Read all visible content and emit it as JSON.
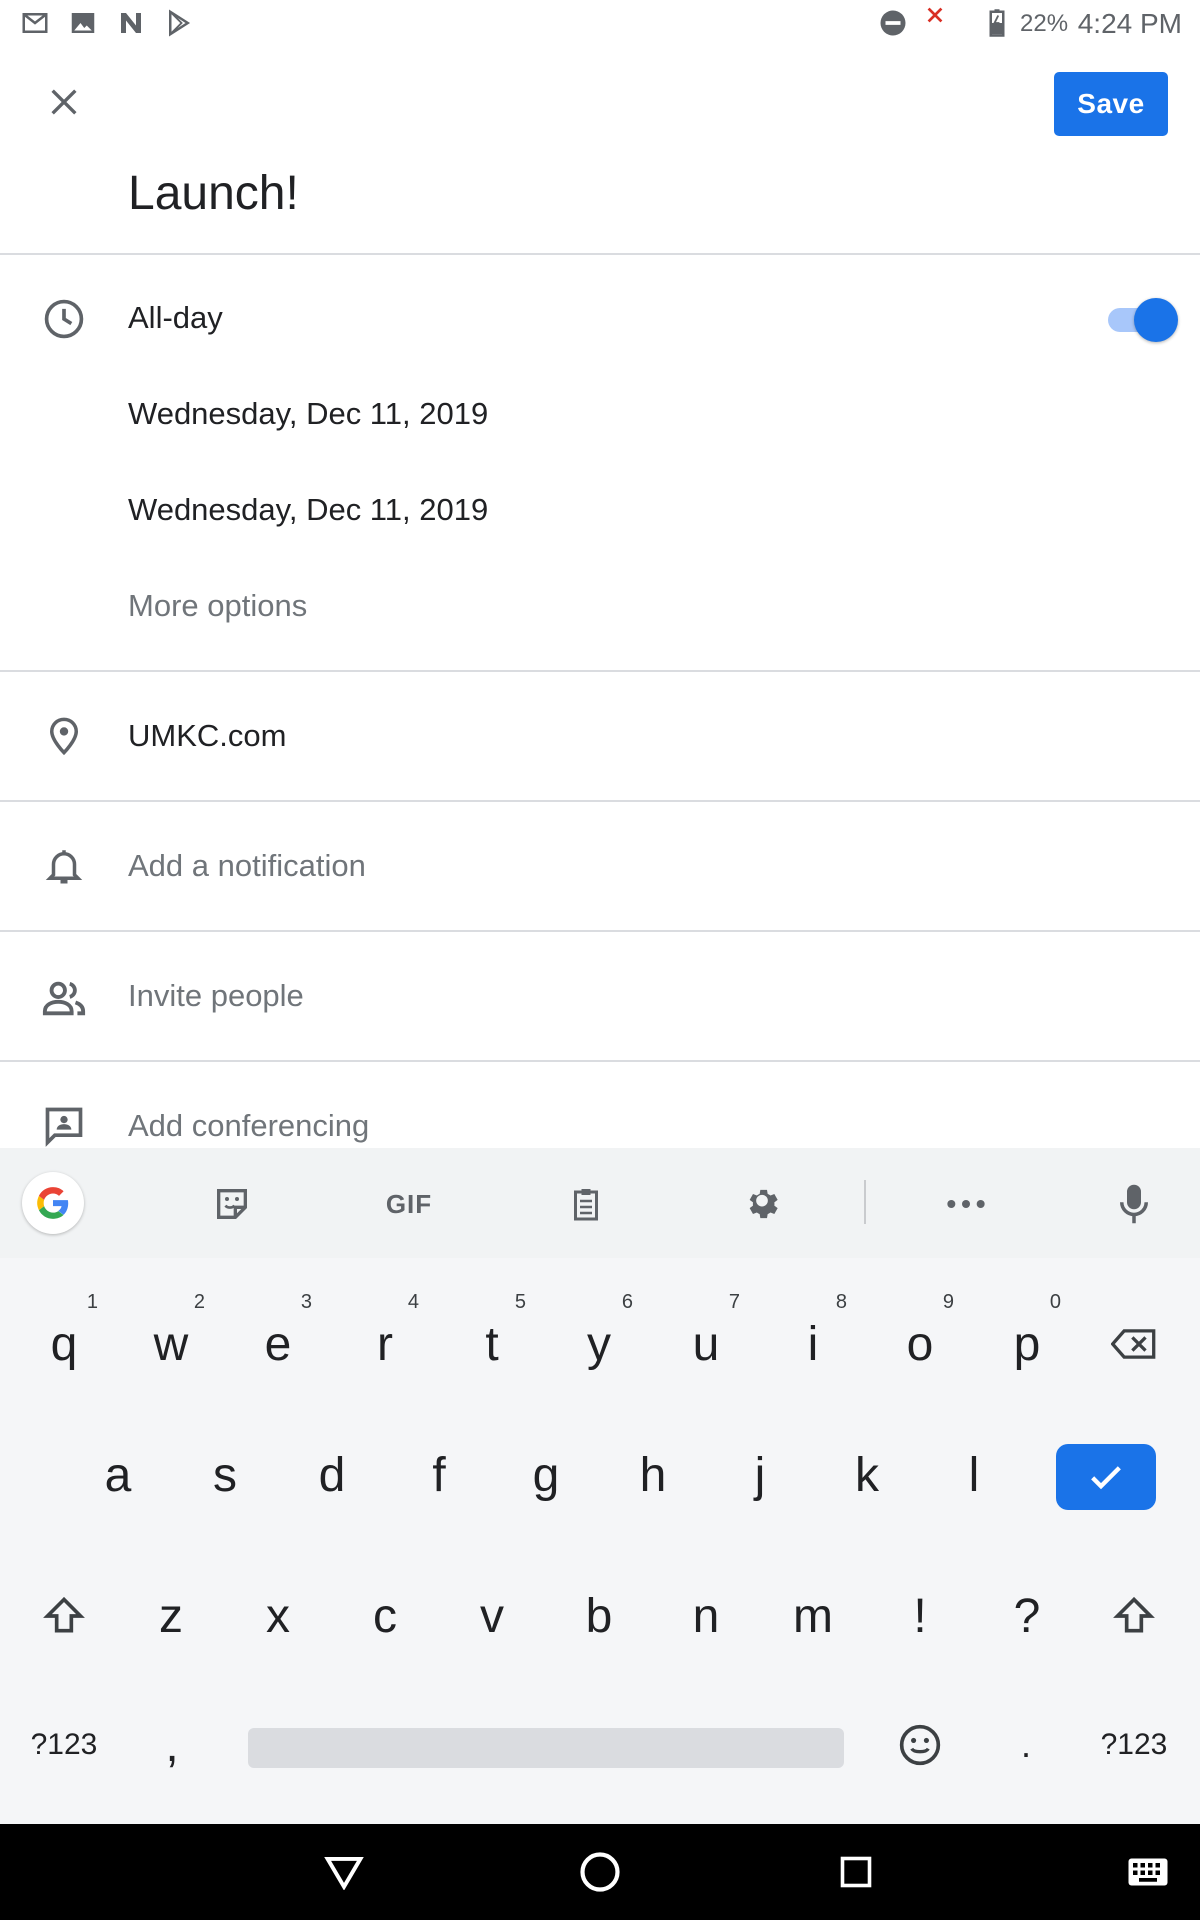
{
  "status_bar": {
    "battery": "22%",
    "time": "4:24 PM",
    "icons": [
      "gmail-icon",
      "photos-icon",
      "news-icon",
      "play-store-icon",
      "do-not-disturb-icon",
      "no-signal-icon",
      "battery-charging-icon"
    ]
  },
  "app_bar": {
    "close_icon": "close-icon",
    "save_label": "Save"
  },
  "event": {
    "title": "Launch!",
    "all_day_label": "All-day",
    "all_day_enabled": true,
    "start_date": "Wednesday, Dec 11, 2019",
    "end_date": "Wednesday, Dec 11, 2019",
    "more_options": "More options",
    "location": "UMKC.com",
    "notification": "Add a notification",
    "invite": "Invite people",
    "conferencing": "Add conferencing"
  },
  "keyboard": {
    "toolbar": [
      "google-icon",
      "sticker-icon",
      "GIF",
      "clipboard-icon",
      "gear-icon",
      "more-icon",
      "mic-icon"
    ],
    "gif_label": "GIF",
    "row1": [
      {
        "k": "q",
        "h": "1"
      },
      {
        "k": "w",
        "h": "2"
      },
      {
        "k": "e",
        "h": "3"
      },
      {
        "k": "r",
        "h": "4"
      },
      {
        "k": "t",
        "h": "5"
      },
      {
        "k": "y",
        "h": "6"
      },
      {
        "k": "u",
        "h": "7"
      },
      {
        "k": "i",
        "h": "8"
      },
      {
        "k": "o",
        "h": "9"
      },
      {
        "k": "p",
        "h": "0"
      }
    ],
    "row2": [
      "a",
      "s",
      "d",
      "f",
      "g",
      "h",
      "j",
      "k",
      "l"
    ],
    "row3": [
      "z",
      "x",
      "c",
      "v",
      "b",
      "n",
      "m",
      "!",
      "?"
    ],
    "row4": {
      "symbols_left": "?123",
      "comma": ",",
      "period": ".",
      "symbols_right": "?123"
    }
  },
  "colors": {
    "accent": "#1a73e8",
    "toggle_track": "#a8c7fa",
    "divider": "#dadce0",
    "muted_text": "#70757a"
  }
}
